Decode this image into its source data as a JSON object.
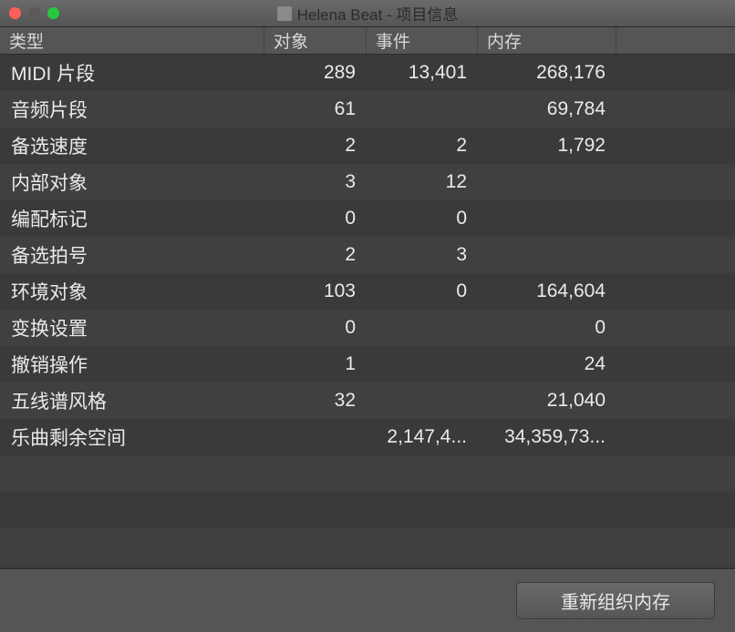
{
  "window": {
    "title": "Helena Beat - 项目信息"
  },
  "columns": {
    "type": "类型",
    "objects": "对象",
    "events": "事件",
    "memory": "内存"
  },
  "rows": [
    {
      "type": "MIDI 片段",
      "objects": "289",
      "events": "13,401",
      "memory": "268,176"
    },
    {
      "type": "音频片段",
      "objects": "61",
      "events": "",
      "memory": "69,784"
    },
    {
      "type": "备选速度",
      "objects": "2",
      "events": "2",
      "memory": "1,792"
    },
    {
      "type": "内部对象",
      "objects": "3",
      "events": "12",
      "memory": ""
    },
    {
      "type": "编配标记",
      "objects": "0",
      "events": "0",
      "memory": ""
    },
    {
      "type": "备选拍号",
      "objects": "2",
      "events": "3",
      "memory": ""
    },
    {
      "type": "环境对象",
      "objects": "103",
      "events": "0",
      "memory": "164,604"
    },
    {
      "type": "变换设置",
      "objects": "0",
      "events": "",
      "memory": "0"
    },
    {
      "type": "撤销操作",
      "objects": "1",
      "events": "",
      "memory": "24"
    },
    {
      "type": "五线谱风格",
      "objects": "32",
      "events": "",
      "memory": "21,040"
    },
    {
      "type": "乐曲剩余空间",
      "objects": "",
      "events": "2,147,4...",
      "memory": "34,359,73..."
    }
  ],
  "footer": {
    "reorganize_button": "重新组织内存"
  }
}
